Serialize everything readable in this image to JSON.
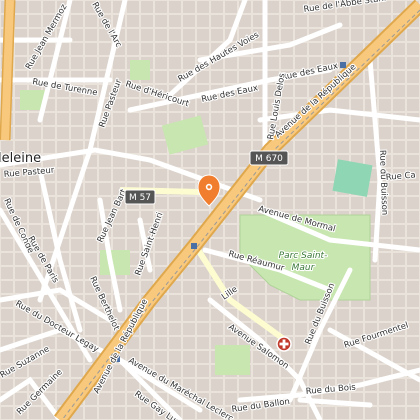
{
  "map": {
    "district_label": "leleine",
    "park_label_line1": "Parc Saint-",
    "park_label_line2": "Maur",
    "road_shields": [
      {
        "id": "m670",
        "label": "M 670"
      },
      {
        "id": "m57",
        "label": "M 57"
      }
    ],
    "streets": [
      {
        "id": "abbe-stahl",
        "label": "Rue de l'Abbé Stahl"
      },
      {
        "id": "jean-mermoz",
        "label": "Rue Jean Mermoz"
      },
      {
        "id": "arc",
        "label": "Rue de l'Arc"
      },
      {
        "id": "turenne",
        "label": "Rue de Turenne"
      },
      {
        "id": "pasteur-v",
        "label": "Rue Pasteur"
      },
      {
        "id": "hericourt",
        "label": "Rue d'Héricourt"
      },
      {
        "id": "hautes-voies",
        "label": "Rue des Hautes Voies"
      },
      {
        "id": "eaux-1",
        "label": "Rue des Eaux"
      },
      {
        "id": "eaux-2",
        "label": "Rue des Eaux"
      },
      {
        "id": "republique-n",
        "label": "Avenue de la République"
      },
      {
        "id": "louis-delos",
        "label": "Rue Louis Delos"
      },
      {
        "id": "buisson-n",
        "label": "Rue du Buisson"
      },
      {
        "id": "rue-pasteur-w",
        "label": "Rue Pasteur"
      },
      {
        "id": "conde",
        "label": "Rue de Condé"
      },
      {
        "id": "jean-bart",
        "label": "Rue Jean Bart"
      },
      {
        "id": "saint-henri",
        "label": "Rue Saint-Henri"
      },
      {
        "id": "paris",
        "label": "Rue de Paris"
      },
      {
        "id": "mormal",
        "label": "Avenue de Mormal"
      },
      {
        "id": "reaumur",
        "label": "Rue Réaumur"
      },
      {
        "id": "berthelot",
        "label": "Rue Berthelot"
      },
      {
        "id": "docteur-legay",
        "label": "Rue du Docteur Legay"
      },
      {
        "id": "buisson-s",
        "label": "Rue du Buisson"
      },
      {
        "id": "fourmentel",
        "label": "Rue Fourmentel"
      },
      {
        "id": "republique-s",
        "label": "Avenue de la République"
      },
      {
        "id": "salomon",
        "label": "Avenue Salomon"
      },
      {
        "id": "suzanne",
        "label": "Rue Suzanne"
      },
      {
        "id": "marechal-leclerc",
        "label": "Avenue du Maréchal Leclerc"
      },
      {
        "id": "germaine",
        "label": "Rue Germaine"
      },
      {
        "id": "guy-lussac",
        "label": "Rue Gay Lussac"
      },
      {
        "id": "bois",
        "label": "Rue du Bois"
      },
      {
        "id": "ballon",
        "label": "Rue du Ballon"
      },
      {
        "id": "ca",
        "label": "Rue Ca"
      },
      {
        "id": "lille",
        "label": "Lille"
      }
    ],
    "colors": {
      "background": "#f2efe9",
      "building": "#d9d0c9",
      "major_road": "#f8c87d",
      "major_road_casing": "#e0a84c",
      "park": "#c8e6b0",
      "pitch": "#8fd6b5",
      "marker": "#f07e2e",
      "shield": "#555555",
      "hospital": "#c0392b"
    },
    "icons": [
      "location-marker-icon",
      "hospital-icon"
    ]
  }
}
